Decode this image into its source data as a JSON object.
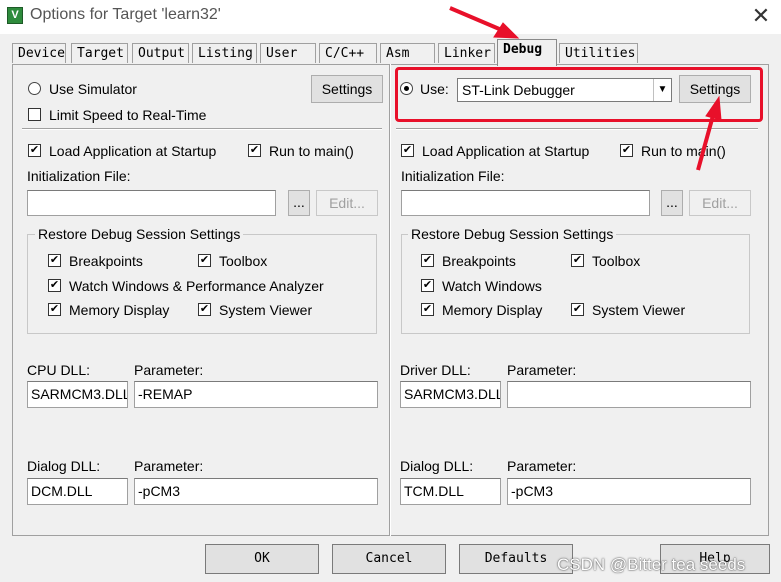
{
  "window": {
    "title": "Options for Target 'learn32'",
    "icon_label": "V",
    "close_glyph": "✕"
  },
  "tabs": [
    "Device",
    "Target",
    "Output",
    "Listing",
    "User",
    "C/C++",
    "Asm",
    "Linker",
    "Debug",
    "Utilities"
  ],
  "active_tab": "Debug",
  "left": {
    "use_simulator": "Use Simulator",
    "limit_speed": "Limit Speed to Real-Time",
    "settings_label": "Settings",
    "load_app": "Load Application at Startup",
    "run_to_main": "Run to main()",
    "init_file": "Initialization File:",
    "browse": "...",
    "edit": "Edit...",
    "restore_group": "Restore Debug Session Settings",
    "breakpoints": "Breakpoints",
    "toolbox": "Toolbox",
    "watch_windows": "Watch Windows & Performance Analyzer",
    "memory_display": "Memory Display",
    "system_viewer": "System Viewer",
    "dll_label": "CPU DLL:",
    "dll_param_label": "Parameter:",
    "dll_value": "SARMCM3.DLL",
    "dll_param_value": "-REMAP",
    "dialog_dll_label": "Dialog DLL:",
    "dialog_param_label": "Parameter:",
    "dialog_dll_value": "DCM.DLL",
    "dialog_param_value": "-pCM3"
  },
  "right": {
    "use_label": "Use:",
    "debugger": "ST-Link Debugger",
    "settings_label": "Settings",
    "load_app": "Load Application at Startup",
    "run_to_main": "Run to main()",
    "init_file": "Initialization File:",
    "browse": "...",
    "edit": "Edit...",
    "restore_group": "Restore Debug Session Settings",
    "breakpoints": "Breakpoints",
    "toolbox": "Toolbox",
    "watch_windows": "Watch Windows",
    "memory_display": "Memory Display",
    "system_viewer": "System Viewer",
    "dll_label": "Driver DLL:",
    "dll_param_label": "Parameter:",
    "dll_value": "SARMCM3.DLL",
    "dll_param_value": "",
    "dialog_dll_label": "Dialog DLL:",
    "dialog_param_label": "Parameter:",
    "dialog_dll_value": "TCM.DLL",
    "dialog_param_value": "-pCM3"
  },
  "buttons": {
    "ok": "OK",
    "cancel": "Cancel",
    "defaults": "Defaults",
    "help": "Help"
  },
  "check_glyph": "✔",
  "dropdown_arrow": "▼",
  "watermark": "CSDN @Bitter tea seeds",
  "annotation_color": "#e8102a"
}
